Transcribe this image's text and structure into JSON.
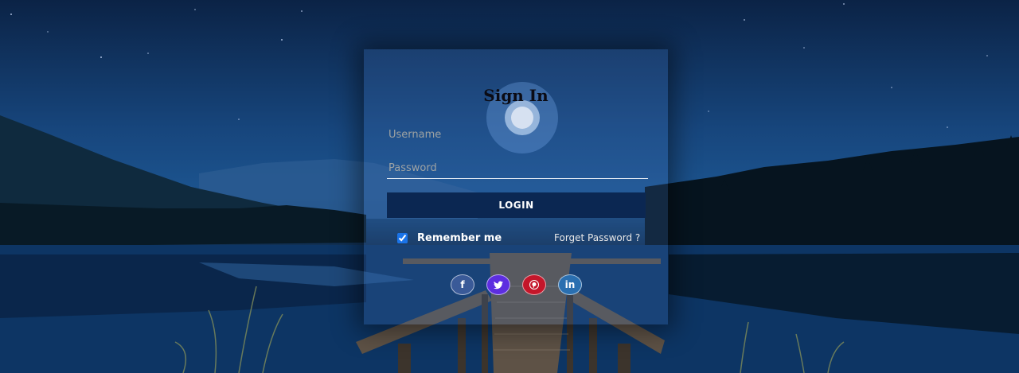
{
  "form": {
    "title": "Sign In",
    "username_placeholder": "Username",
    "password_placeholder": "Password",
    "login_label": "LOGIN",
    "remember_label": "Remember me",
    "remember_checked": true,
    "forget_label": "Forget Password ?"
  },
  "social": [
    {
      "name": "facebook",
      "glyph": "f",
      "color": "#3a5a98"
    },
    {
      "name": "twitter",
      "glyph": "t",
      "color": "#5d2ee0"
    },
    {
      "name": "pinterest",
      "glyph": "p",
      "color": "#c4162a"
    },
    {
      "name": "linkedin",
      "glyph": "in",
      "color": "#2a6fb0"
    }
  ],
  "background": {
    "description_icon": "lake-pier-night-icon",
    "sky_color": "#17467d",
    "water_color": "#0d3968"
  }
}
